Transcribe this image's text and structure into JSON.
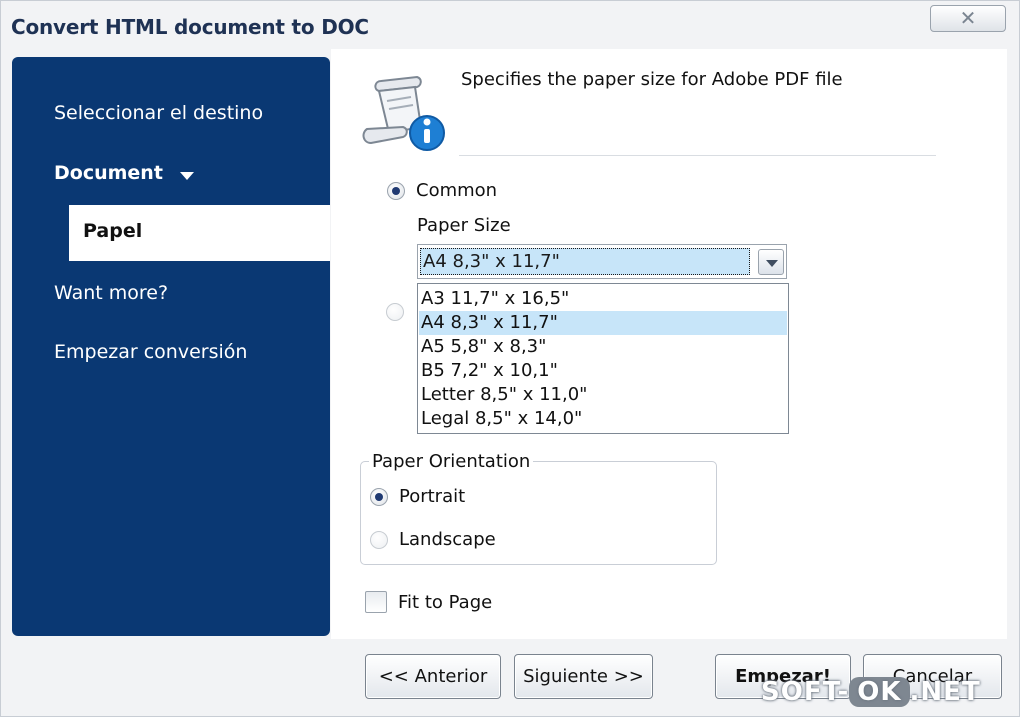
{
  "window": {
    "title": "Convert HTML document to DOC",
    "close_glyph": "✕"
  },
  "sidebar": {
    "items": [
      {
        "label": "Seleccionar el destino"
      },
      {
        "label": "Document"
      },
      {
        "label": "Papel",
        "active": true
      },
      {
        "label": "Want more?"
      },
      {
        "label": "Empezar conversión"
      }
    ]
  },
  "header": {
    "icon": "scroll-info-icon",
    "description": "Specifies the paper size for Adobe PDF file"
  },
  "paper": {
    "common_label": "Common",
    "common_selected": true,
    "custom_selected": false,
    "size_label": "Paper Size",
    "selected_value": "A4 8,3\" x 11,7\"",
    "options": [
      "A3 11,7\" x 16,5\"",
      "A4 8,3\" x 11,7\"",
      "A5 5,8\" x 8,3\"",
      "B5 7,2\" x 10,1\"",
      "Letter 8,5\" x 11,0\"",
      "Legal 8,5\" x 14,0\""
    ],
    "highlighted_option_index": 1
  },
  "orientation": {
    "group_label": "Paper Orientation",
    "portrait_label": "Portrait",
    "landscape_label": "Landscape",
    "selected": "Portrait"
  },
  "fit_to_page": {
    "label": "Fit to Page",
    "checked": false
  },
  "buttons": {
    "back": "<< Anterior",
    "next": "Siguiente >>",
    "start": "Empezar!",
    "cancel": "Cancelar"
  },
  "watermark": {
    "left": "SOFT-",
    "ok": "OK",
    "right": ".NET"
  },
  "colors": {
    "sidebar": "#0a3873",
    "selection": "#c7e5f9",
    "title": "#1f3254"
  }
}
